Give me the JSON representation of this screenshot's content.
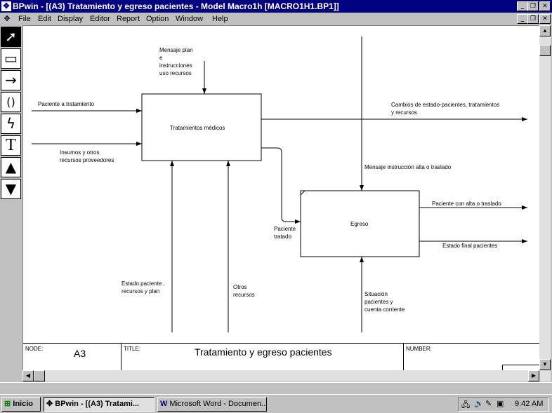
{
  "window": {
    "title": "BPwin - [(A3) Tratamiento y egreso pacientes - Model Macro1h  [MACRO1H1.BP1]]",
    "buttons": {
      "minimize": "_",
      "restore": "❐",
      "close": "✕"
    }
  },
  "menu": [
    "File",
    "Edit",
    "Display",
    "Editor",
    "Report",
    "Option",
    "Window",
    "Help"
  ],
  "toolbox": {
    "items": [
      {
        "name": "pointer-tool",
        "glyph": "➚"
      },
      {
        "name": "box-tool",
        "glyph": "▭"
      },
      {
        "name": "arrow-tool",
        "glyph": "→"
      },
      {
        "name": "squiggle-tool",
        "glyph": "()"
      },
      {
        "name": "lightning-tool",
        "glyph": "ϟ"
      },
      {
        "name": "text-tool",
        "glyph": "T"
      },
      {
        "name": "go-up-tool",
        "glyph": "▲"
      },
      {
        "name": "go-down-tool",
        "glyph": "▼"
      }
    ]
  },
  "diagram": {
    "boxes": {
      "box1": "Tratamientos médicos",
      "box2": "Egreso"
    },
    "labels": {
      "mensaje_plan": [
        "Mensaje plan",
        "e",
        "instrucciones",
        "uso recursos"
      ],
      "paciente_tratamiento": [
        "Paciente a tratamiento"
      ],
      "insumos": [
        "Insumos y otros",
        "recursos proveedores"
      ],
      "cambios": [
        "Cambios de estado-pacientes, tratamientos",
        "y  recursos"
      ],
      "mensaje_alta": [
        "Mensaje instrucción alta o traslado"
      ],
      "paciente_tratado": [
        "Paciente",
        "tratado"
      ],
      "alta_traslado": [
        "Paciente con alta o traslado"
      ],
      "estado_final": [
        "Estado final pacientes"
      ],
      "estado_paciente": [
        "Estado paciente ,",
        "recursos  y plan"
      ],
      "otros_recursos": [
        "Otros",
        "recursos"
      ],
      "situacion": [
        "Situación",
        "pacientes y",
        "cuenta corriente"
      ]
    }
  },
  "footer": {
    "node_label": "NODE:",
    "node_value": "A3",
    "title_label": "TITLE:",
    "title_value": "Tratamiento y egreso pacientes",
    "number_label": "NUMBER:"
  },
  "scroll": {
    "up": "▲",
    "down": "▼",
    "left": "◀",
    "right": "▶"
  },
  "taskbar": {
    "start": "Inicio",
    "tasks": [
      {
        "label": "BPwin - [(A3) Tratami...",
        "active": true
      },
      {
        "label": "Microsoft Word - Documen...",
        "active": false
      }
    ],
    "clock": "9:42 AM"
  }
}
